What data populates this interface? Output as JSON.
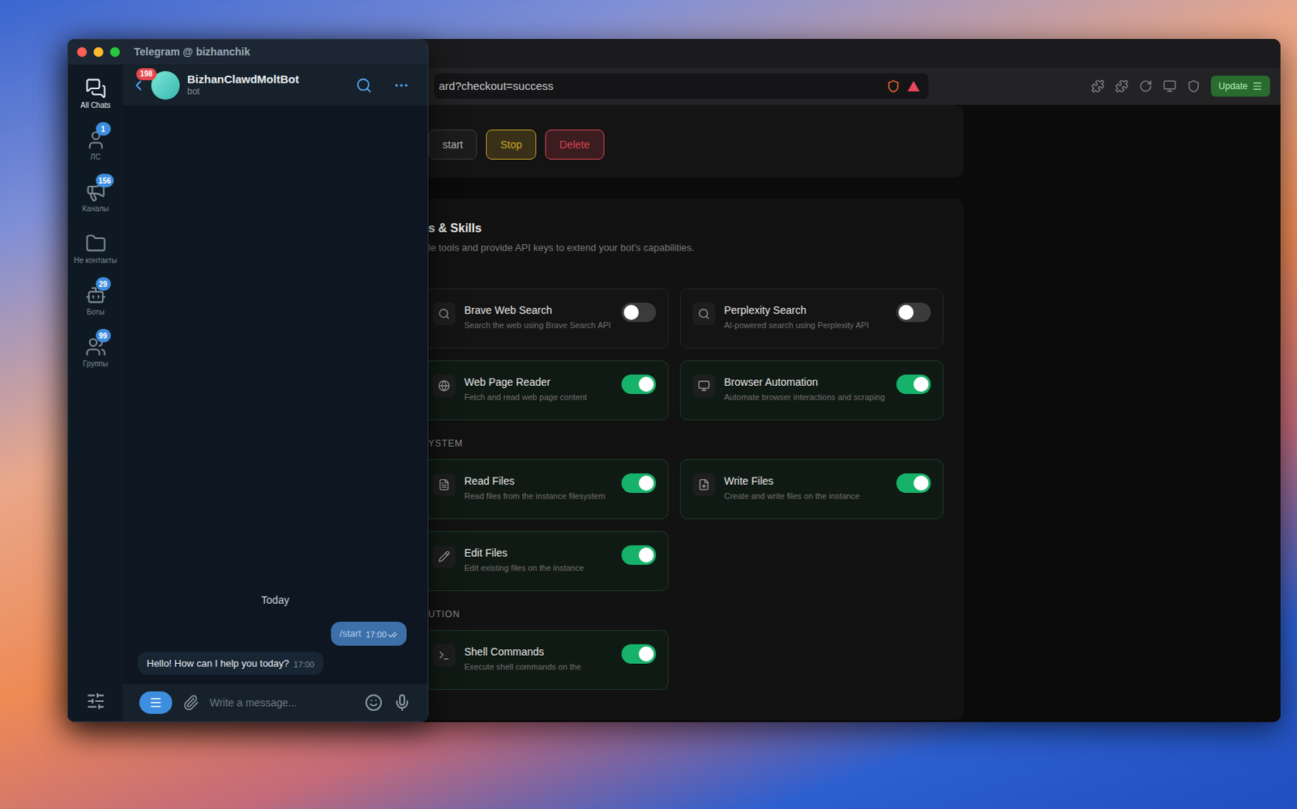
{
  "telegram": {
    "title": "Telegram @ bizhanchik",
    "folders": [
      {
        "label": "All Chats",
        "badge": "",
        "selected": true
      },
      {
        "label": "ЛС",
        "badge": "1",
        "selected": false
      },
      {
        "label": "Каналы",
        "badge": "156",
        "selected": false
      },
      {
        "label": "Не контакты",
        "badge": "",
        "selected": false
      },
      {
        "label": "Боты",
        "badge": "29",
        "selected": false
      },
      {
        "label": "Группы",
        "badge": "99",
        "selected": false
      }
    ],
    "chat": {
      "name": "BizhanClawdMoltBot",
      "status": "bot",
      "back_badge": "198"
    },
    "date": "Today",
    "messages": [
      {
        "text": "/start",
        "time": "17:00",
        "outgoing": true,
        "read": true
      },
      {
        "text": "Hello! How can I help you today?",
        "time": "17:00",
        "outgoing": false,
        "read": false
      }
    ],
    "input": {
      "placeholder": "Write a message..."
    }
  },
  "browser": {
    "url": "ard?checkout=success",
    "update_button": "Update",
    "buttons": [
      {
        "label": "start",
        "color": "#3a3a3a"
      },
      {
        "label": "Stop",
        "color": "#c9a227"
      },
      {
        "label": "Delete",
        "color": "#d9434f"
      }
    ],
    "section": {
      "title": "s & Skills",
      "description": "le tools and provide API keys to extend your bot's capabilities."
    },
    "groups": [
      {
        "label": "",
        "tools": [
          {
            "name": "Brave Web Search",
            "description": "Search the web using Brave Search API",
            "on": false
          },
          {
            "name": "Perplexity Search",
            "description": "AI-powered search using Perplexity API",
            "on": false
          },
          {
            "name": "Web Page Reader",
            "description": "Fetch and read web page content",
            "on": true
          },
          {
            "name": "Browser Automation",
            "description": "Automate browser interactions and scraping",
            "on": true
          }
        ]
      },
      {
        "label": "YSTEM",
        "tools": [
          {
            "name": "Read Files",
            "description": "Read files from the instance filesystem",
            "on": true
          },
          {
            "name": "Write Files",
            "description": "Create and write files on the instance",
            "on": true
          },
          {
            "name": "Edit Files",
            "description": "Edit existing files on the instance",
            "on": true
          }
        ]
      },
      {
        "label": "UTION",
        "tools": [
          {
            "name": "Shell Commands",
            "description": "Execute shell commands on the",
            "on": true
          }
        ]
      }
    ]
  }
}
